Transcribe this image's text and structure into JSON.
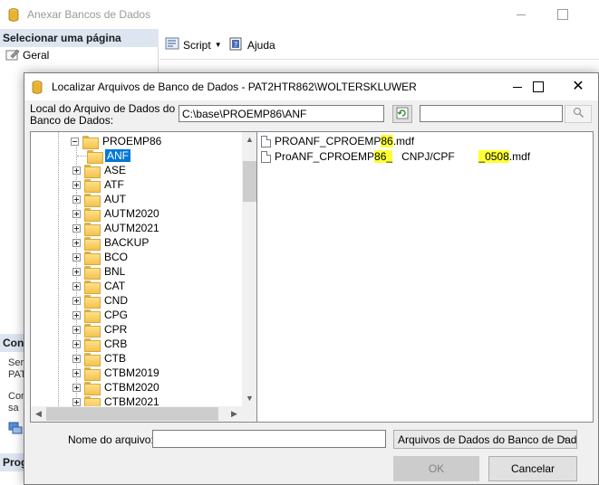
{
  "background_window": {
    "title": "Anexar Bancos de Dados",
    "select_page_header": "Selecionar uma página",
    "pages": [
      "Geral"
    ],
    "toolbar": {
      "script_label": "Script",
      "help_label": "Ajuda"
    },
    "connection_header": "Con",
    "progress_header": "Prog",
    "partial_texts": [
      "Ser",
      "PAT",
      "Con",
      "sa"
    ]
  },
  "dialog": {
    "title": "Localizar Arquivos de Banco de Dados - PAT2HTR862\\WOLTERSKLUWER",
    "location_label": "Local do Arquivo de Dados do Banco de Dados:",
    "location_path": "C:\\base\\PROEMP86\\ANF",
    "search_value": "",
    "tree": {
      "parent": "PROEMP86",
      "selected": "ANF",
      "children": [
        "ASE",
        "ATF",
        "AUT",
        "AUTM2020",
        "AUTM2021",
        "BACKUP",
        "BCO",
        "BNL",
        "CAT",
        "CND",
        "CPG",
        "CPR",
        "CRB",
        "CTB",
        "CTBM2019",
        "CTBM2020",
        "CTBM2021"
      ]
    },
    "files": [
      {
        "prefix": "PROANF_CPROEMP",
        "highlight": "86",
        "mid": "",
        "highlight2": "",
        "suffix": ".mdf"
      },
      {
        "prefix": "ProANF_CPROEMP",
        "highlight": "86_",
        "mid": "   CNPJ/CPF        ",
        "highlight2": "_0508",
        "suffix": ".mdf"
      }
    ],
    "filename_label": "Nome do arquivo:",
    "filename_value": "",
    "filetype_selected": "Arquivos de Dados do Banco de Dados",
    "ok_label": "OK",
    "cancel_label": "Cancelar"
  }
}
